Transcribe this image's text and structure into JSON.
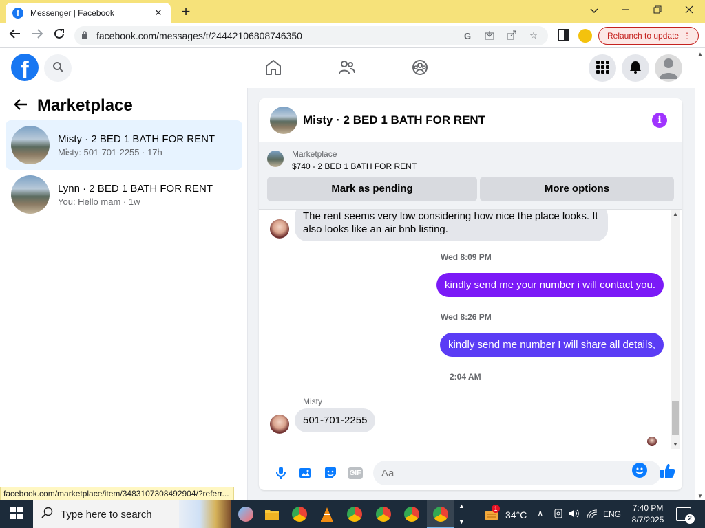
{
  "browser": {
    "tab_title": "Messenger | Facebook",
    "url": "facebook.com/messages/t/24442106808746350",
    "relaunch_label": "Relaunch to update",
    "status_url": "facebook.com/marketplace/item/3483107308492904/?referr..."
  },
  "left": {
    "title": "Marketplace",
    "conversations": [
      {
        "name": "Misty · 2 BED 1 BATH FOR RENT",
        "preview": "Misty: 501-701-2255 · 17h"
      },
      {
        "name": "Lynn · 2 BED 1 BATH FOR RENT",
        "preview": "You: Hello mam · 1w"
      }
    ]
  },
  "chat": {
    "header_name": "Misty · 2 BED 1 BATH FOR RENT",
    "marketplace_label": "Marketplace",
    "listing": "$740 - 2 BED 1 BATH FOR RENT",
    "mark_pending": "Mark as pending",
    "more_options": "More options",
    "incoming_1": "The rent seems very low considering how nice the place looks. It also looks like an air bnb listing.",
    "time_1": "Wed 8:09 PM",
    "outgoing_1": "kindly send me your number i will contact you.",
    "time_2": "Wed 8:26 PM",
    "outgoing_2": "kindly send me number I will share all details,",
    "time_3": "2:04 AM",
    "sender_name": "Misty",
    "incoming_2": "501-701-2255",
    "composer_placeholder": "Aa",
    "gif_label": "GIF"
  },
  "taskbar": {
    "search_placeholder": "Type here to search",
    "weather": "34°C",
    "language": "ENG",
    "time": "7:40 PM",
    "date": "8/7/2025",
    "notification_count": "2",
    "weather_badge": "1"
  },
  "colors": {
    "tabstrip": "#f6e27a",
    "fb_blue": "#1877f2",
    "outgoing_1": "#7b1af7",
    "outgoing_2": "#5b3cf5",
    "active_conversation": "#e7f3ff",
    "info_purple": "#a033ff"
  }
}
